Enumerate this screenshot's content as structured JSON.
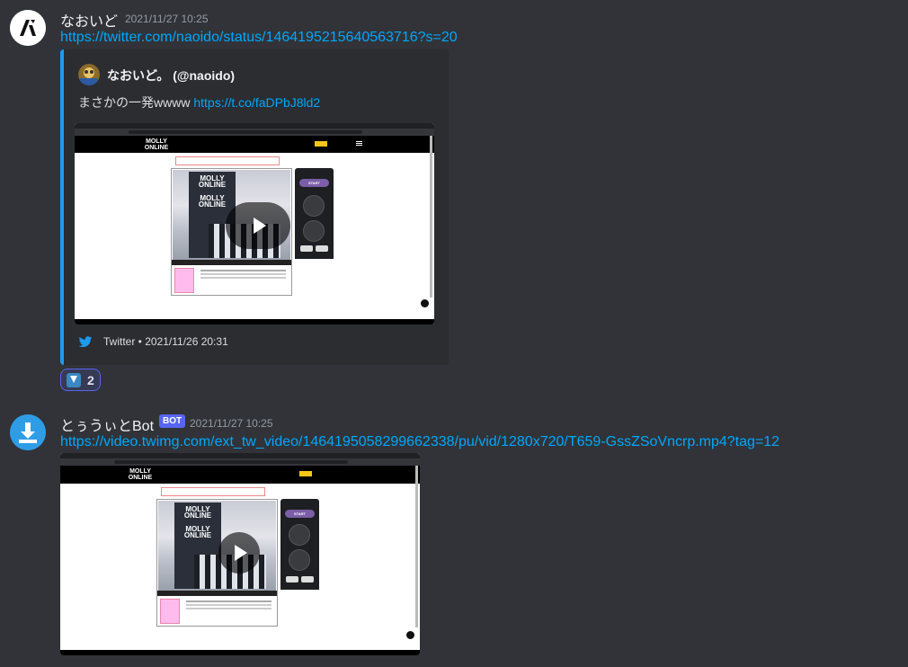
{
  "messages": [
    {
      "username": "なおいど",
      "timestamp": "2021/11/27 10:25",
      "link": "https://twitter.com/naoido/status/1464195215640563716?s=20",
      "embed": {
        "author": "なおいど。 (@naoido)",
        "description_text": "まさかの一発wwww",
        "description_link": "https://t.co/faDPbJ8ld2",
        "footer": "Twitter • 2021/11/26 20:31",
        "accent_color": "#1d9bf0"
      },
      "reaction": {
        "emoji": "arrow-down-emoji",
        "count": "2"
      }
    },
    {
      "username": "とぅうぃとBot",
      "bot_tag": "BOT",
      "timestamp": "2021/11/27 10:25",
      "link": "https://video.twimg.com/ext_tw_video/1464195058299662338/pu/vid/1280x720/T659-GssZSoVncrp.mp4?tag=12"
    }
  ],
  "video": {
    "site_logo_line1": "MOLLY",
    "site_logo_line2": "ONLINE",
    "start_label": "START"
  },
  "colors": {
    "background": "#313338",
    "link": "#00a8fc",
    "bot_tag": "#5865f2"
  }
}
